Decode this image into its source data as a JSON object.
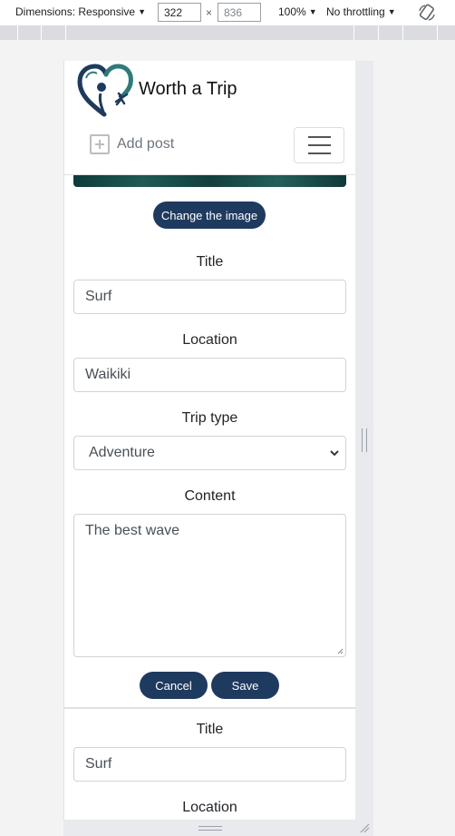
{
  "devtools": {
    "dimensions_label": "Dimensions: Responsive",
    "width": "322",
    "height": "836",
    "times": "×",
    "zoom": "100%",
    "throttle": "No throttling"
  },
  "navbar": {
    "brand": "Worth a Trip",
    "add_post": "Add post"
  },
  "form": {
    "change_image_label": "Change the image",
    "title_label": "Title",
    "title_value": "Surf",
    "location_label": "Location",
    "location_value": "Waikiki",
    "trip_type_label": "Trip type",
    "trip_type_value": "Adventure",
    "content_label": "Content",
    "content_value": "The best wave",
    "cancel_label": "Cancel",
    "save_label": "Save"
  },
  "next_card": {
    "title_label": "Title",
    "title_value": "Surf",
    "location_label": "Location"
  },
  "colors": {
    "primary_button": "#1f3a5f",
    "logo_navy": "#1e3a5c",
    "logo_teal": "#2f7a7a"
  }
}
